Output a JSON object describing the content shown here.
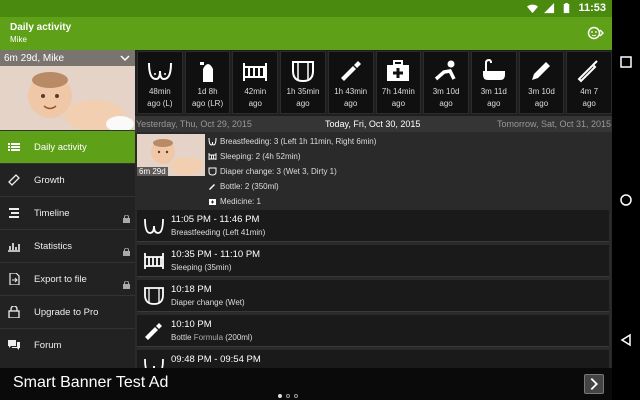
{
  "status": {
    "time": "11:53"
  },
  "app": {
    "title": "Daily activity",
    "subtitle": "Mike"
  },
  "profile": {
    "name": "6m 29d, Mike"
  },
  "nav": [
    {
      "label": "Daily activity",
      "icon": "list-icon",
      "active": true
    },
    {
      "label": "Growth",
      "icon": "ruler-icon"
    },
    {
      "label": "Timeline",
      "icon": "timeline-icon",
      "locked": true
    },
    {
      "label": "Statistics",
      "icon": "chart-icon",
      "locked": true
    },
    {
      "label": "Export to file",
      "icon": "export-icon",
      "locked": true
    },
    {
      "label": "Upgrade to Pro",
      "icon": "lock-icon"
    },
    {
      "label": "Forum",
      "icon": "forum-icon"
    }
  ],
  "quick": [
    {
      "icon": "breastfeeding-icon",
      "l1": "48min",
      "l2": "ago (L)"
    },
    {
      "icon": "pump-icon",
      "l1": "1d 8h",
      "l2": "ago (LR)"
    },
    {
      "icon": "crib-icon",
      "l1": "42min",
      "l2": "ago"
    },
    {
      "icon": "diaper-icon",
      "l1": "1h 35min",
      "l2": "ago"
    },
    {
      "icon": "bottle-icon",
      "l1": "1h 43min",
      "l2": "ago"
    },
    {
      "icon": "medicine-icon",
      "l1": "7h 14min",
      "l2": "ago"
    },
    {
      "icon": "crawl-icon",
      "l1": "3m 10d",
      "l2": "ago"
    },
    {
      "icon": "bath-icon",
      "l1": "3m 11d",
      "l2": "ago"
    },
    {
      "icon": "pencil-icon",
      "l1": "3m 10d",
      "l2": "ago"
    },
    {
      "icon": "thermometer-icon",
      "l1": "4m 7",
      "l2": "ago"
    }
  ],
  "dates": {
    "prev": "Yesterday, Thu, Oct 29, 2015",
    "today": "Today, Fri, Oct 30, 2015",
    "next": "Tomorrow, Sat, Oct 31, 2015"
  },
  "summary": {
    "age": "6m 29d",
    "lines": [
      "Breastfeeding: 3 (Left 1h 11min, Right 6min)",
      "Sleeping: 2 (4h 52min)",
      "Diaper change: 3 (Wet 3, Dirty 1)",
      "Bottle: 2 (350ml)",
      "Medicine: 1"
    ]
  },
  "events": [
    {
      "icon": "breastfeeding-icon",
      "time": "11:05 PM - 11:46 PM",
      "desc": "Breastfeeding (Left 41min)"
    },
    {
      "icon": "crib-icon",
      "time": "10:35 PM - 11:10 PM",
      "desc": "Sleeping (35min)"
    },
    {
      "icon": "diaper-icon",
      "time": "10:18 PM",
      "desc": "Diaper change (Wet)"
    },
    {
      "icon": "bottle-icon",
      "time": "10:10 PM",
      "desc_pre": "Bottle ",
      "desc_muted": "Formula",
      "desc_post": " (200ml)"
    },
    {
      "icon": "breastfeeding-icon",
      "time": "09:48 PM - 09:54 PM",
      "desc": ""
    }
  ],
  "ad": {
    "text": "Smart Banner Test Ad"
  }
}
